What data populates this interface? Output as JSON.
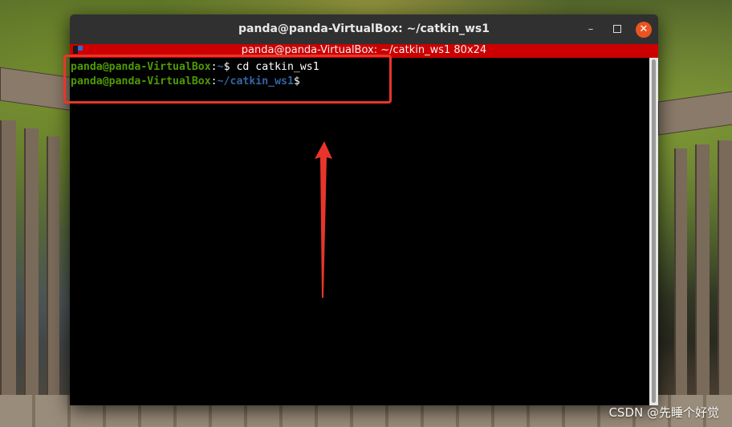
{
  "window": {
    "title": "panda@panda-VirtualBox: ~/catkin_ws1",
    "controls": {
      "minimize": "–",
      "maximize": "",
      "close": "✕"
    }
  },
  "tab": {
    "title": "panda@panda-VirtualBox: ~/catkin_ws1 80x24"
  },
  "terminal": {
    "lines": [
      {
        "user": "panda@panda-VirtualBox",
        "colon": ":",
        "path": "~",
        "prompt": "$ ",
        "command": "cd catkin_ws1"
      },
      {
        "user": "panda@panda-VirtualBox",
        "colon": ":",
        "path": "~/catkin_ws1",
        "prompt": "$",
        "command": ""
      }
    ]
  },
  "colors": {
    "user": "#4e9a06",
    "path": "#3465a4",
    "tab_bar": "#cc0000",
    "close_button": "#e95420",
    "annotation": "#e8352b"
  },
  "watermark": "CSDN @先睡个好觉"
}
